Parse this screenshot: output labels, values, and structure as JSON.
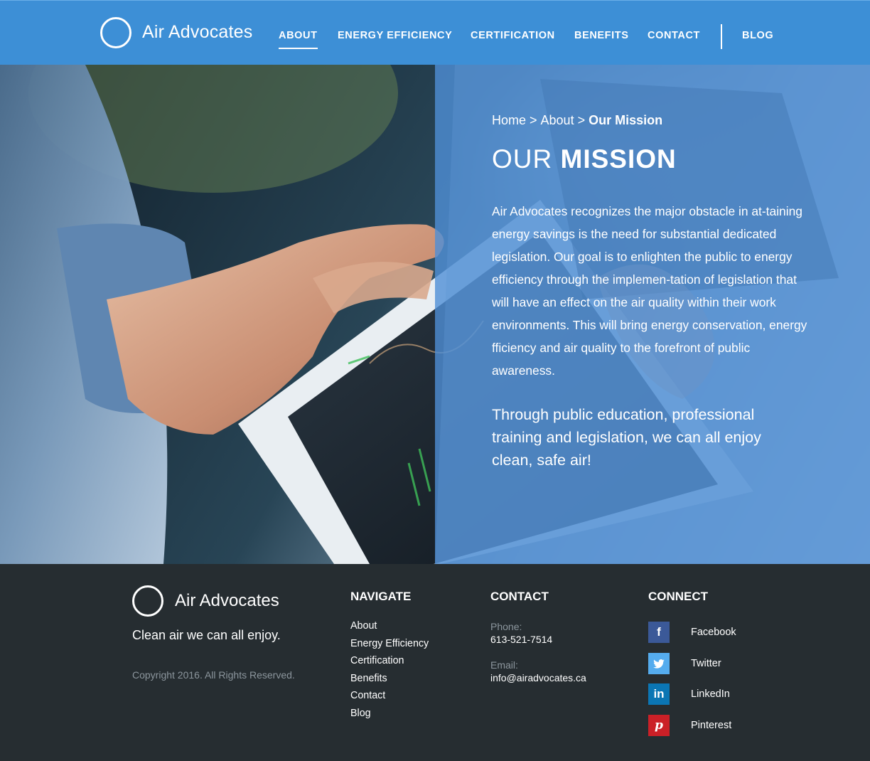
{
  "brand": {
    "name": "Air Advocates"
  },
  "nav": {
    "items": [
      {
        "label": "ABOUT"
      },
      {
        "label": "ENERGY EFFICIENCY"
      },
      {
        "label": "CERTIFICATION"
      },
      {
        "label": "BENEFITS"
      },
      {
        "label": "CONTACT"
      },
      {
        "label": "BLOG"
      }
    ],
    "active": "ABOUT"
  },
  "hero": {
    "breadcrumb": {
      "home": "Home",
      "separator": ">",
      "about": "About",
      "current": "Our Mission"
    },
    "title_light": "OUR",
    "title_bold": "MISSION",
    "body": "Air Advocates recognizes the major obstacle in at-taining energy savings is the need for substantial dedicated legislation. Our goal is to enlighten the public to energy efficiency through the implemen-tation of legislation that will have an effect on the air quality within their work environments. This will bring energy conservation, energy fficiency and air quality to the forefront of public awareness.",
    "callout": "Through public education, professional training and legislation, we can all enjoy clean, safe air!"
  },
  "footer": {
    "brand_name": "Air Advocates",
    "tagline": "Clean air we can all enjoy.",
    "copyright": "Copyright 2016. All Rights Reserved.",
    "navigate": {
      "heading": "NAVIGATE",
      "links": [
        "About",
        "Energy Efficiency",
        "Certification",
        "Benefits",
        "Contact",
        "Blog"
      ]
    },
    "contact": {
      "heading": "CONTACT",
      "phone_label": "Phone:",
      "phone": "613-521-7514",
      "email_label": "Email:",
      "email": "info@airadvocates.ca"
    },
    "connect": {
      "heading": "CONNECT",
      "items": [
        {
          "label": "Facebook",
          "icon": "facebook-icon",
          "glyph": "f",
          "color": "#3b5998"
        },
        {
          "label": "Twitter",
          "icon": "twitter-icon",
          "glyph": "t",
          "color": "#55acee"
        },
        {
          "label": "LinkedIn",
          "icon": "linkedin-icon",
          "glyph": "in",
          "color": "#0b76b4"
        },
        {
          "label": "Pinterest",
          "icon": "pinterest-icon",
          "glyph": "p",
          "color": "#cb2027"
        }
      ]
    }
  },
  "colors": {
    "header_blue": "#3d8fd6",
    "overlay_blue": "#4f8ed6",
    "footer_bg": "#262d31",
    "muted_text": "#8c969d"
  }
}
